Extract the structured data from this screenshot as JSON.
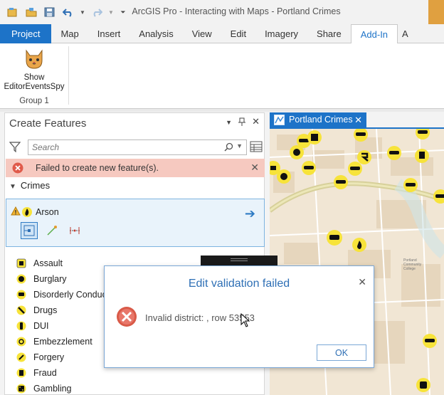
{
  "app": {
    "title": "ArcGIS Pro - Interacting with Maps - Portland Crimes"
  },
  "quick_access": [
    "new-project-icon",
    "open-project-icon",
    "save-project-icon",
    "undo-icon",
    "redo-icon",
    "customize-icon"
  ],
  "ribbon": {
    "tabs": [
      "Project",
      "Map",
      "Insert",
      "Analysis",
      "View",
      "Edit",
      "Imagery",
      "Share",
      "Add-In",
      "A"
    ],
    "active_tab": "Add-In",
    "button_label_line1": "Show",
    "button_label_line2": "EditorEventsSpy",
    "group_label": "Group 1"
  },
  "create_features": {
    "title": "Create Features",
    "search_placeholder": "Search",
    "error_text": "Failed to create new feature(s).",
    "group_name": "Crimes",
    "selected_template": "Arson",
    "features": [
      "Assault",
      "Burglary",
      "Disorderly Conduct",
      "Drugs",
      "DUI",
      "Embezzlement",
      "Forgery",
      "Fraud",
      "Gambling"
    ]
  },
  "map_view": {
    "tab_title": "Portland Crimes"
  },
  "dialog": {
    "title": "Edit validation failed",
    "message": "Invalid district: , row 53553",
    "ok_label": "OK"
  },
  "colors": {
    "accent": "#1d73c8",
    "error_bg": "#f6c9c0",
    "error_icon": "#e05a4a",
    "map_bg": "#f1e6d4",
    "marker": "#f7e33a"
  }
}
